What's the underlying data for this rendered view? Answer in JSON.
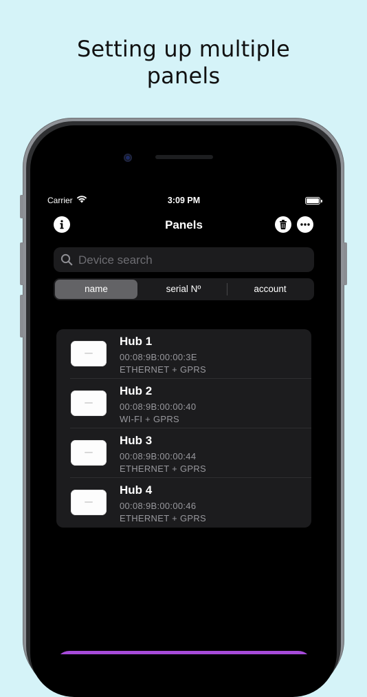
{
  "headline": {
    "line1": "Setting up multiple",
    "line2": "panels"
  },
  "status_bar": {
    "carrier": "Carrier",
    "time": "3:09 PM"
  },
  "nav": {
    "title": "Panels",
    "left_icon": "info-icon",
    "right_icons": [
      "trash-icon",
      "more-icon"
    ]
  },
  "search": {
    "placeholder": "Device search",
    "value": ""
  },
  "segments": {
    "items": [
      "name",
      "serial Nº",
      "account"
    ],
    "selected": "name"
  },
  "hubs": [
    {
      "name": "Hub 1",
      "mac": "00:08:9B:00:00:3E",
      "connection": "ETHERNET + GPRS"
    },
    {
      "name": "Hub 2",
      "mac": "00:08:9B:00:00:40",
      "connection": "WI-FI + GPRS"
    },
    {
      "name": "Hub 3",
      "mac": "00:08:9B:00:00:44",
      "connection": "ETHERNET + GPRS"
    },
    {
      "name": "Hub 4",
      "mac": "00:08:9B:00:00:46",
      "connection": "ETHERNET + GPRS"
    }
  ],
  "colors": {
    "background": "#d5f3f8",
    "screen": "#000000",
    "cell": "#1c1c1e",
    "accent": "#a64bd9"
  }
}
